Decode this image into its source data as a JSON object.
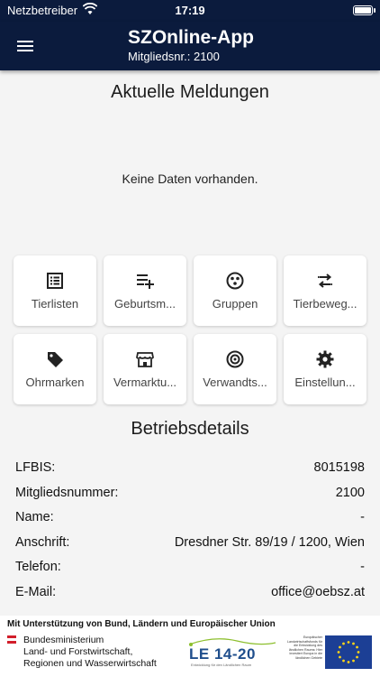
{
  "status_bar": {
    "carrier": "Netzbetreiber",
    "time": "17:19"
  },
  "app_bar": {
    "title": "SZOnline-App",
    "subtitle": "Mitgliedsnr.: 2100"
  },
  "news": {
    "title": "Aktuelle Meldungen",
    "empty_message": "Keine Daten vorhanden."
  },
  "tiles": [
    {
      "label": "Tierlisten",
      "icon": "list-icon"
    },
    {
      "label": "Geburtsm...",
      "icon": "playlist-add-icon"
    },
    {
      "label": "Gruppen",
      "icon": "group-icon"
    },
    {
      "label": "Tierbeweg...",
      "icon": "swap-arrows-icon"
    },
    {
      "label": "Ohrmarken",
      "icon": "tag-icon"
    },
    {
      "label": "Vermarktu...",
      "icon": "store-icon"
    },
    {
      "label": "Verwandts...",
      "icon": "target-icon"
    },
    {
      "label": "Einstellun...",
      "icon": "gear-icon"
    }
  ],
  "details": {
    "title": "Betriebsdetails",
    "rows": [
      {
        "key": "LFBIS:",
        "value": "8015198"
      },
      {
        "key": "Mitgliedsnummer:",
        "value": "2100"
      },
      {
        "key": "Name:",
        "value": "-"
      },
      {
        "key": "Anschrift:",
        "value": "Dresdner Str. 89/19 / 1200, Wien"
      },
      {
        "key": "Telefon:",
        "value": "-"
      },
      {
        "key": "E-Mail:",
        "value": "office@oebsz.at"
      }
    ]
  },
  "footer": {
    "support_text": "Mit Unterstützung von Bund, Ländern und Europäischer Union",
    "ministry_line1": "Bundesministerium",
    "ministry_line2": "Land- und Forstwirtschaft,",
    "ministry_line3": "Regionen und Wasserwirtschaft",
    "le_logo_text": "LE 14-20",
    "le_logo_subtext": "Entwicklung für den Ländlichen Raum",
    "eu_text": "Europäischer Landwirtschaftsfonds für die Entwicklung des ländlichen Raums: Hier investiert Europa in die ländlichen Gebiete"
  },
  "colors": {
    "app_bar": "#0b1b3d",
    "background": "#f4f4f4",
    "tile": "#ffffff",
    "eu_blue": "#1c3f95",
    "eu_star": "#ffd617"
  }
}
